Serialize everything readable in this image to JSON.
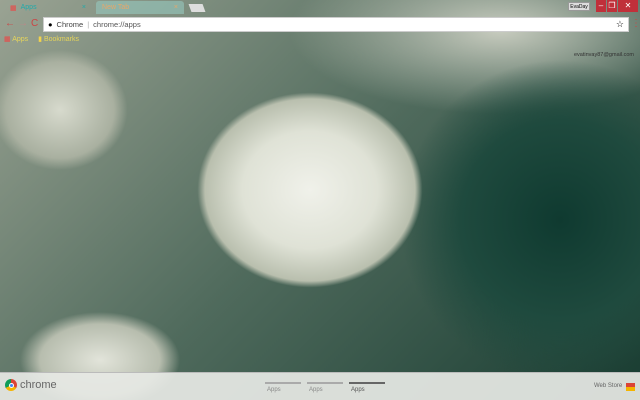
{
  "tabs": [
    {
      "title": "Apps",
      "close": "×"
    },
    {
      "title": "New Tab",
      "close": "×"
    }
  ],
  "window": {
    "user": "EvaDay",
    "minimize": "–",
    "restore": "❐",
    "close": "✕"
  },
  "toolbar": {
    "back": "←",
    "forward": "→",
    "reload": "C",
    "site_label": "Chrome",
    "url": "chrome://apps",
    "star": "☆",
    "menu": "⋮"
  },
  "bookmarks": [
    {
      "label": "Apps"
    },
    {
      "label": "Bookmarks"
    }
  ],
  "account": {
    "email": "evatinvay87@gmail.com"
  },
  "footer": {
    "logo_text": "chrome",
    "pages": [
      "Apps",
      "Apps",
      "Apps"
    ],
    "active_page": 2,
    "webstore": "Web Store"
  }
}
